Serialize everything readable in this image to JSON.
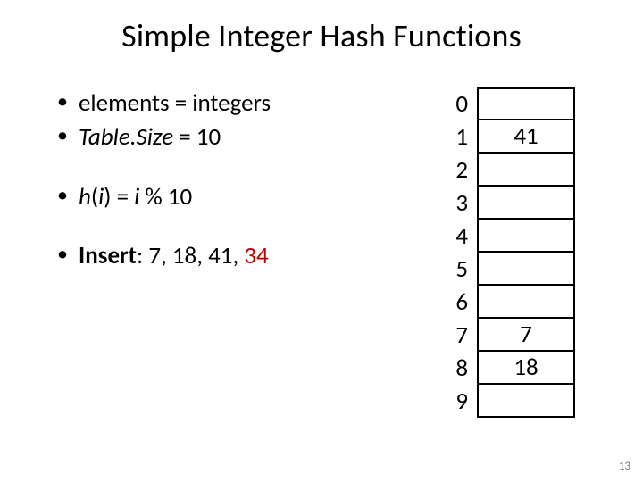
{
  "title": "Simple Integer Hash Functions",
  "bullets": {
    "b1_pre": "elements = integers",
    "b2_italic": "Table.Size",
    "b2_rest": " = 10",
    "b3_h": "h",
    "b3_paren_open": "(",
    "b3_i1": "i",
    "b3_mid": ") = ",
    "b3_i2": "i",
    "b3_end": " % 10",
    "b4_bold": "Insert",
    "b4_rest": ": 7, 18, 41, ",
    "b4_red": "34"
  },
  "table": {
    "indices": [
      "0",
      "1",
      "2",
      "3",
      "4",
      "5",
      "6",
      "7",
      "8",
      "9"
    ],
    "values": [
      "",
      "41",
      "",
      "",
      "",
      "",
      "",
      "7",
      "18",
      ""
    ]
  },
  "page_number": "13"
}
